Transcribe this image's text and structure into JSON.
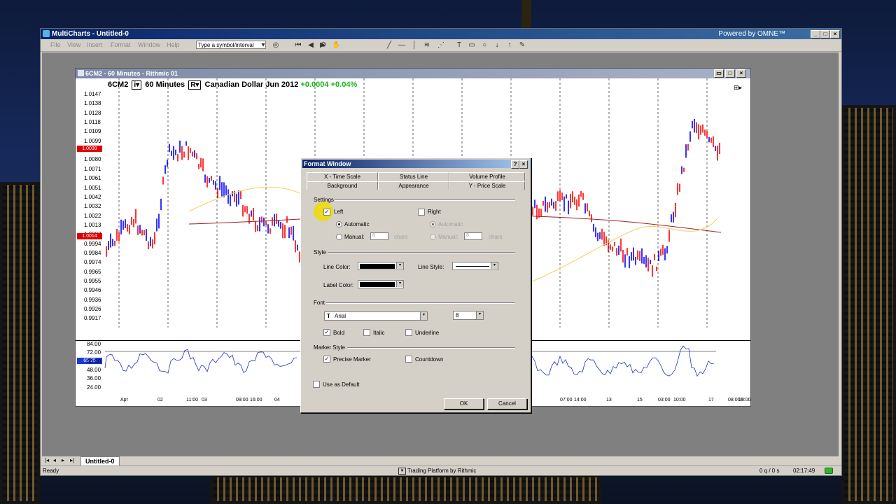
{
  "app": {
    "title": "MultiCharts - Untitled-0",
    "powered_by": "Powered by OMNE™",
    "menu": [
      "File",
      "View",
      "Insert",
      "Format",
      "Window",
      "Help"
    ],
    "symbol_placeholder": "Type a symbol/interval"
  },
  "chart_window": {
    "title": "6CM2 - 60 Minutes - Rithmic 01",
    "symbol": "6CM2",
    "interval": "60 Minutes",
    "i_button": "i▾",
    "r_button": "R▾",
    "description": "Canadian Dollar Jun 2012",
    "change": "+0.0004",
    "change_pct": "+0.04%",
    "price_ticks": [
      "1.0147",
      "1.0138",
      "1.0128",
      "1.0118",
      "1.0109",
      "1.0099",
      "1.0090",
      "1.0080",
      "1.0071",
      "1.0061",
      "1.0051",
      "1.0042",
      "1.0032",
      "1.0022",
      "1.0013",
      "1.0003",
      "0.9994",
      "0.9984",
      "0.9974",
      "0.9965",
      "0.9955",
      "0.9946",
      "0.9936",
      "0.9926",
      "0.9917"
    ],
    "price_marker_top": "1.0099",
    "price_marker_bottom": "1.0014",
    "osc_ticks": [
      "84.00",
      "72.00",
      "60.00",
      "48.00",
      "36.00",
      "24.00"
    ],
    "osc_marker": "65.35",
    "time_labels": [
      "Apr",
      "02",
      "11:00",
      "03",
      "09:00",
      "16:00",
      "04",
      "07:00",
      "14:00",
      "05",
      "07:00",
      "14:00",
      "13",
      "15",
      "03:00",
      "10:00",
      "17",
      "08:00",
      "15:00",
      "18"
    ]
  },
  "dialog": {
    "title": "Format Window",
    "tabs_row1": [
      "X - Time Scale",
      "Status Line",
      "Volume Profile"
    ],
    "tabs_row2": [
      "Background",
      "Appearance",
      "Y - Price Scale"
    ],
    "settings_label": "Settings",
    "left_label": "Left",
    "right_label": "Right",
    "automatic_label": "Automatic",
    "manual_label": "Manual:",
    "manual_value": "8",
    "chars_label": "chars",
    "style_label": "Style",
    "line_color_label": "Line Color:",
    "line_style_label": "Line Style:",
    "label_color_label": "Label Color:",
    "font_label": "Font",
    "font_name": "Arial",
    "font_size": "8",
    "bold_label": "Bold",
    "italic_label": "Italic",
    "underline_label": "Underline",
    "marker_style_label": "Marker Style",
    "precise_marker_label": "Precise Marker",
    "countdown_label": "Countdown",
    "use_default_label": "Use as Default",
    "ok_label": "OK",
    "cancel_label": "Cancel"
  },
  "bottom": {
    "tab_label": "Untitled-0",
    "status_ready": "Ready",
    "trading_platform": "Trading Platform by Rithmic",
    "queue": "0 q / 0 s",
    "clock": "02:17:49"
  },
  "colors": {
    "up": "#0000ff",
    "down": "#ff0000",
    "titlebar": "#0a246a",
    "marker": "#e00000"
  }
}
